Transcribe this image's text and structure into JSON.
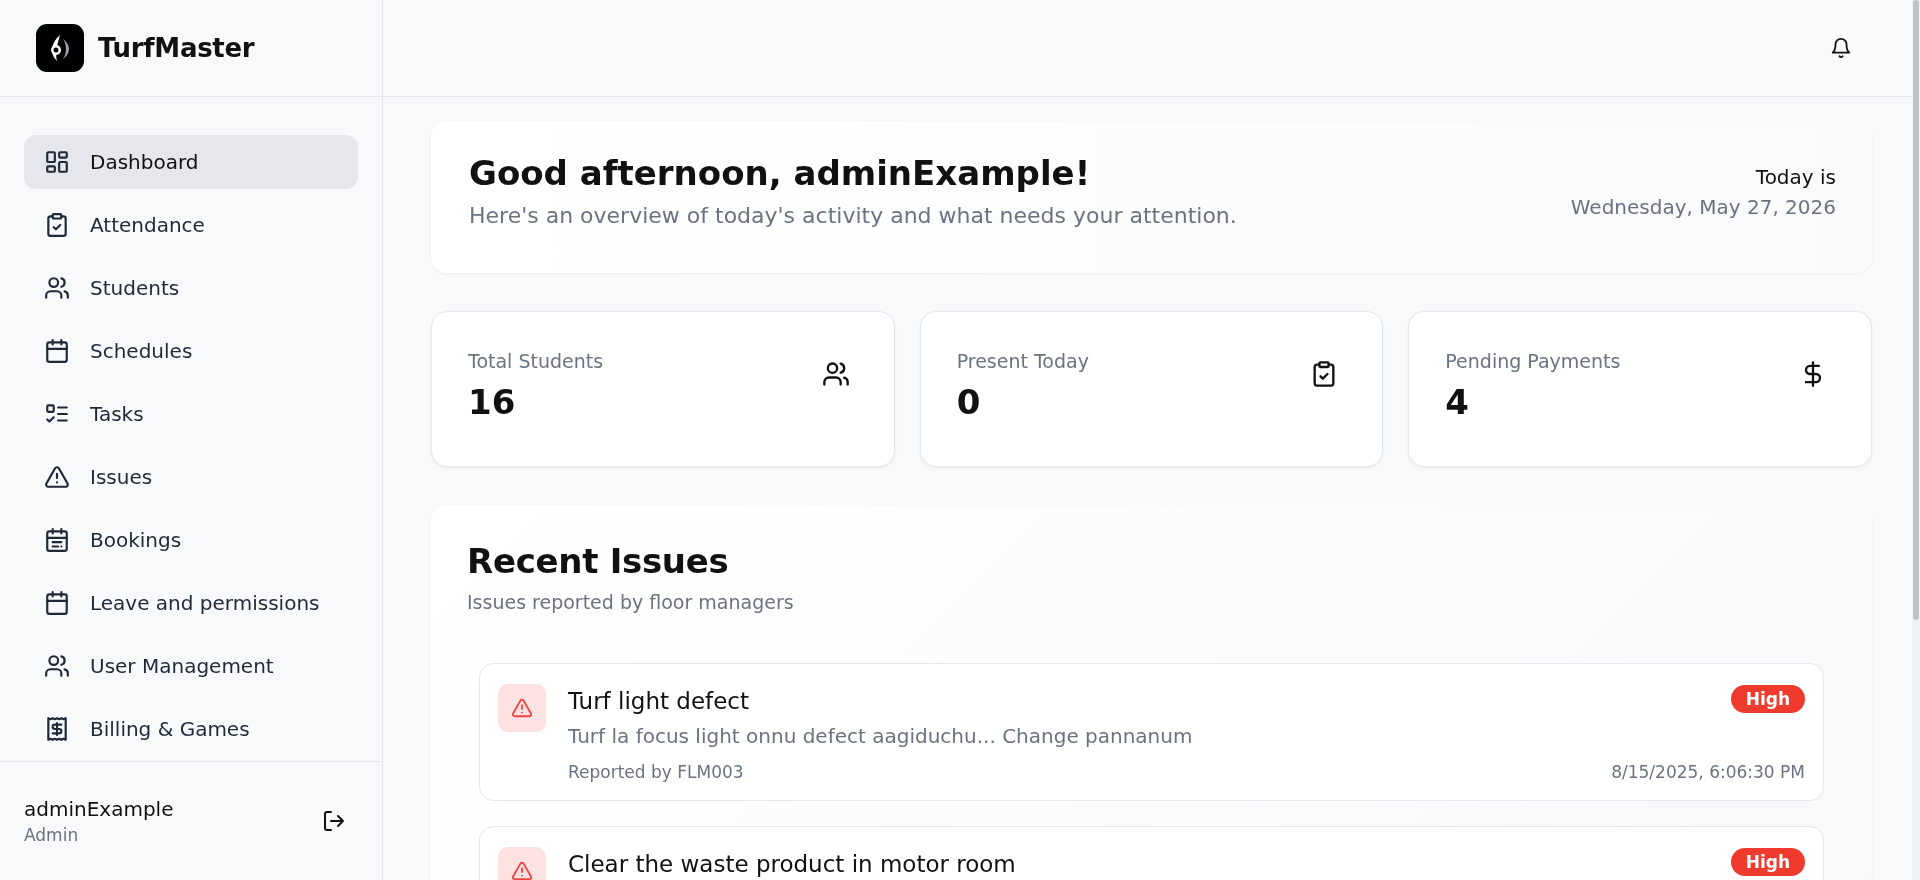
{
  "brand": {
    "name": "TurfMaster"
  },
  "sidebar": {
    "items": [
      {
        "label": "Dashboard",
        "selected": true
      },
      {
        "label": "Attendance",
        "selected": false
      },
      {
        "label": "Students",
        "selected": false
      },
      {
        "label": "Schedules",
        "selected": false
      },
      {
        "label": "Tasks",
        "selected": false
      },
      {
        "label": "Issues",
        "selected": false
      },
      {
        "label": "Bookings",
        "selected": false
      },
      {
        "label": "Leave and permissions",
        "selected": false
      },
      {
        "label": "User Management",
        "selected": false
      },
      {
        "label": "Billing & Games",
        "selected": false
      }
    ],
    "user": {
      "name": "adminExample",
      "role": "Admin"
    }
  },
  "welcome": {
    "title": "Good afternoon, adminExample!",
    "subtitle": "Here's an overview of today's activity and what needs your attention.",
    "date_label": "Today is",
    "date": "Wednesday, May 27, 2026"
  },
  "stats": [
    {
      "label": "Total Students",
      "value": "16"
    },
    {
      "label": "Present Today",
      "value": "0"
    },
    {
      "label": "Pending Payments",
      "value": "4"
    }
  ],
  "recent_issues": {
    "title": "Recent Issues",
    "subtitle": "Issues reported by floor managers",
    "items": [
      {
        "title": "Turf light defect",
        "description": "Turf la focus light onnu defect aagiduchu... Change pannanum",
        "reporter": "Reported by FLM003",
        "time": "8/15/2025, 6:06:30 PM",
        "priority": "High"
      },
      {
        "title": "Clear the waste product in motor room",
        "priority": "High"
      }
    ]
  }
}
